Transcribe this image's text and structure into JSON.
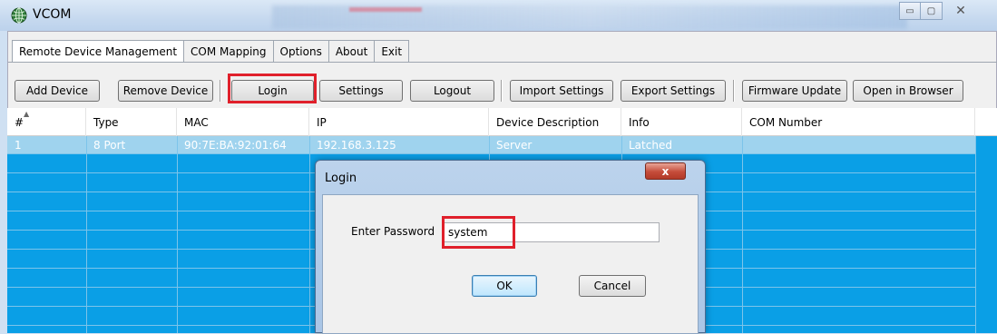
{
  "window": {
    "title": "VCOM",
    "icon": "globe-network-icon",
    "controls": [
      "minimize-icon",
      "maximize-icon",
      "close-icon"
    ]
  },
  "tabs": [
    {
      "label": "Remote Device Management",
      "active": true
    },
    {
      "label": "COM Mapping",
      "active": false
    },
    {
      "label": "Options",
      "active": false
    },
    {
      "label": "About",
      "active": false
    },
    {
      "label": "Exit",
      "active": false
    }
  ],
  "toolbar": {
    "add_device": "Add Device",
    "remove_device": "Remove Device",
    "login": "Login",
    "settings": "Settings",
    "logout": "Logout",
    "import_settings": "Import Settings",
    "export_settings": "Export Settings",
    "firmware_update": "Firmware Update",
    "open_in_browser": "Open in Browser"
  },
  "grid": {
    "columns": [
      "#",
      "Type",
      "MAC",
      "IP",
      "Device Description",
      "Info",
      "COM Number"
    ],
    "rows": [
      [
        "1",
        "8 Port",
        "90:7E:BA:92:01:64",
        "192.168.3.125",
        "Server",
        "Latched",
        ""
      ]
    ],
    "selected_row_color": "#9fd3ee",
    "background_color": "#0a9fe6"
  },
  "login_dialog": {
    "title": "Login",
    "close_label": "x",
    "password_label": "Enter Password",
    "password_value": "system",
    "ok_label": "OK",
    "cancel_label": "Cancel"
  },
  "highlight_color": "#e0202b"
}
